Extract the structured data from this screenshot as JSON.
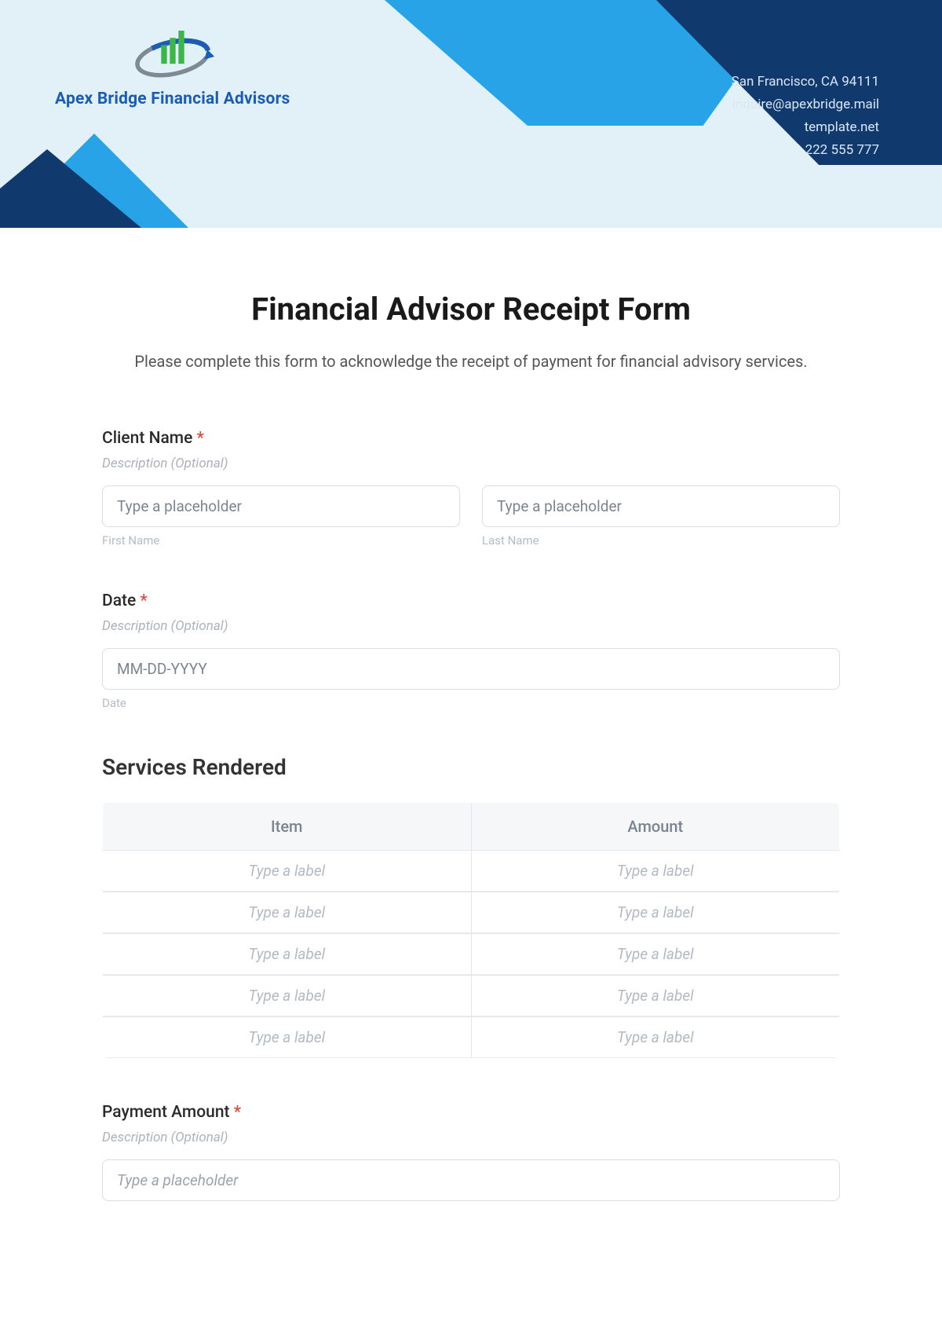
{
  "header": {
    "company_name": "Apex Bridge Financial Advisors",
    "contact": {
      "address": "San Francisco, CA 94111",
      "email": "inquire@apexbridge.mail",
      "website": "template.net",
      "phone": "222 555 777"
    }
  },
  "form": {
    "title": "Financial Advisor Receipt Form",
    "description": "Please complete this form to acknowledge the receipt of payment for financial advisory services.",
    "client_name": {
      "label": "Client Name",
      "required_mark": "*",
      "sublabel": "Description (Optional)",
      "first_placeholder": "Type a placeholder",
      "last_placeholder": "Type a placeholder",
      "first_hint": "First Name",
      "last_hint": "Last Name"
    },
    "date": {
      "label": "Date",
      "required_mark": "*",
      "sublabel": "Description (Optional)",
      "placeholder": "MM-DD-YYYY",
      "hint": "Date"
    },
    "services": {
      "section_title": "Services Rendered",
      "col_item": "Item",
      "col_amount": "Amount",
      "rows": [
        {
          "item_ph": "Type a label",
          "amount_ph": "Type a label"
        },
        {
          "item_ph": "Type a label",
          "amount_ph": "Type a label"
        },
        {
          "item_ph": "Type a label",
          "amount_ph": "Type a label"
        },
        {
          "item_ph": "Type a label",
          "amount_ph": "Type a label"
        },
        {
          "item_ph": "Type a label",
          "amount_ph": "Type a label"
        }
      ]
    },
    "payment": {
      "label": "Payment Amount",
      "required_mark": "*",
      "sublabel": "Description (Optional)",
      "placeholder": "Type a placeholder"
    }
  }
}
